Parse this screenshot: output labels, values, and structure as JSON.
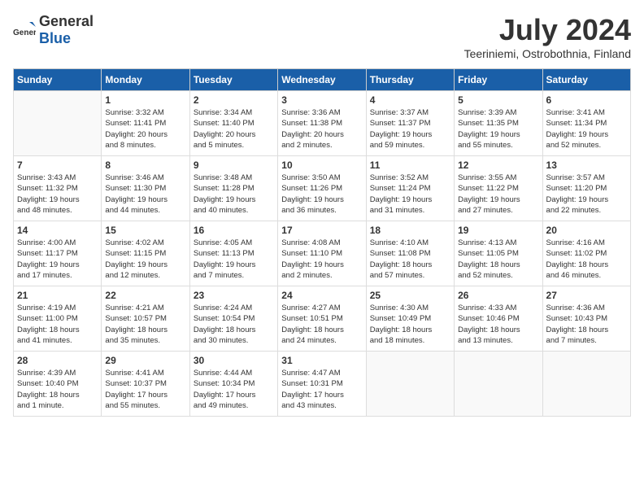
{
  "header": {
    "logo_general": "General",
    "logo_blue": "Blue",
    "month": "July 2024",
    "location": "Teeriniemi, Ostrobothnia, Finland"
  },
  "weekdays": [
    "Sunday",
    "Monday",
    "Tuesday",
    "Wednesday",
    "Thursday",
    "Friday",
    "Saturday"
  ],
  "weeks": [
    [
      {
        "day": "",
        "info": ""
      },
      {
        "day": "1",
        "info": "Sunrise: 3:32 AM\nSunset: 11:41 PM\nDaylight: 20 hours\nand 8 minutes."
      },
      {
        "day": "2",
        "info": "Sunrise: 3:34 AM\nSunset: 11:40 PM\nDaylight: 20 hours\nand 5 minutes."
      },
      {
        "day": "3",
        "info": "Sunrise: 3:36 AM\nSunset: 11:38 PM\nDaylight: 20 hours\nand 2 minutes."
      },
      {
        "day": "4",
        "info": "Sunrise: 3:37 AM\nSunset: 11:37 PM\nDaylight: 19 hours\nand 59 minutes."
      },
      {
        "day": "5",
        "info": "Sunrise: 3:39 AM\nSunset: 11:35 PM\nDaylight: 19 hours\nand 55 minutes."
      },
      {
        "day": "6",
        "info": "Sunrise: 3:41 AM\nSunset: 11:34 PM\nDaylight: 19 hours\nand 52 minutes."
      }
    ],
    [
      {
        "day": "7",
        "info": "Sunrise: 3:43 AM\nSunset: 11:32 PM\nDaylight: 19 hours\nand 48 minutes."
      },
      {
        "day": "8",
        "info": "Sunrise: 3:46 AM\nSunset: 11:30 PM\nDaylight: 19 hours\nand 44 minutes."
      },
      {
        "day": "9",
        "info": "Sunrise: 3:48 AM\nSunset: 11:28 PM\nDaylight: 19 hours\nand 40 minutes."
      },
      {
        "day": "10",
        "info": "Sunrise: 3:50 AM\nSunset: 11:26 PM\nDaylight: 19 hours\nand 36 minutes."
      },
      {
        "day": "11",
        "info": "Sunrise: 3:52 AM\nSunset: 11:24 PM\nDaylight: 19 hours\nand 31 minutes."
      },
      {
        "day": "12",
        "info": "Sunrise: 3:55 AM\nSunset: 11:22 PM\nDaylight: 19 hours\nand 27 minutes."
      },
      {
        "day": "13",
        "info": "Sunrise: 3:57 AM\nSunset: 11:20 PM\nDaylight: 19 hours\nand 22 minutes."
      }
    ],
    [
      {
        "day": "14",
        "info": "Sunrise: 4:00 AM\nSunset: 11:17 PM\nDaylight: 19 hours\nand 17 minutes."
      },
      {
        "day": "15",
        "info": "Sunrise: 4:02 AM\nSunset: 11:15 PM\nDaylight: 19 hours\nand 12 minutes."
      },
      {
        "day": "16",
        "info": "Sunrise: 4:05 AM\nSunset: 11:13 PM\nDaylight: 19 hours\nand 7 minutes."
      },
      {
        "day": "17",
        "info": "Sunrise: 4:08 AM\nSunset: 11:10 PM\nDaylight: 19 hours\nand 2 minutes."
      },
      {
        "day": "18",
        "info": "Sunrise: 4:10 AM\nSunset: 11:08 PM\nDaylight: 18 hours\nand 57 minutes."
      },
      {
        "day": "19",
        "info": "Sunrise: 4:13 AM\nSunset: 11:05 PM\nDaylight: 18 hours\nand 52 minutes."
      },
      {
        "day": "20",
        "info": "Sunrise: 4:16 AM\nSunset: 11:02 PM\nDaylight: 18 hours\nand 46 minutes."
      }
    ],
    [
      {
        "day": "21",
        "info": "Sunrise: 4:19 AM\nSunset: 11:00 PM\nDaylight: 18 hours\nand 41 minutes."
      },
      {
        "day": "22",
        "info": "Sunrise: 4:21 AM\nSunset: 10:57 PM\nDaylight: 18 hours\nand 35 minutes."
      },
      {
        "day": "23",
        "info": "Sunrise: 4:24 AM\nSunset: 10:54 PM\nDaylight: 18 hours\nand 30 minutes."
      },
      {
        "day": "24",
        "info": "Sunrise: 4:27 AM\nSunset: 10:51 PM\nDaylight: 18 hours\nand 24 minutes."
      },
      {
        "day": "25",
        "info": "Sunrise: 4:30 AM\nSunset: 10:49 PM\nDaylight: 18 hours\nand 18 minutes."
      },
      {
        "day": "26",
        "info": "Sunrise: 4:33 AM\nSunset: 10:46 PM\nDaylight: 18 hours\nand 13 minutes."
      },
      {
        "day": "27",
        "info": "Sunrise: 4:36 AM\nSunset: 10:43 PM\nDaylight: 18 hours\nand 7 minutes."
      }
    ],
    [
      {
        "day": "28",
        "info": "Sunrise: 4:39 AM\nSunset: 10:40 PM\nDaylight: 18 hours\nand 1 minute."
      },
      {
        "day": "29",
        "info": "Sunrise: 4:41 AM\nSunset: 10:37 PM\nDaylight: 17 hours\nand 55 minutes."
      },
      {
        "day": "30",
        "info": "Sunrise: 4:44 AM\nSunset: 10:34 PM\nDaylight: 17 hours\nand 49 minutes."
      },
      {
        "day": "31",
        "info": "Sunrise: 4:47 AM\nSunset: 10:31 PM\nDaylight: 17 hours\nand 43 minutes."
      },
      {
        "day": "",
        "info": ""
      },
      {
        "day": "",
        "info": ""
      },
      {
        "day": "",
        "info": ""
      }
    ]
  ]
}
